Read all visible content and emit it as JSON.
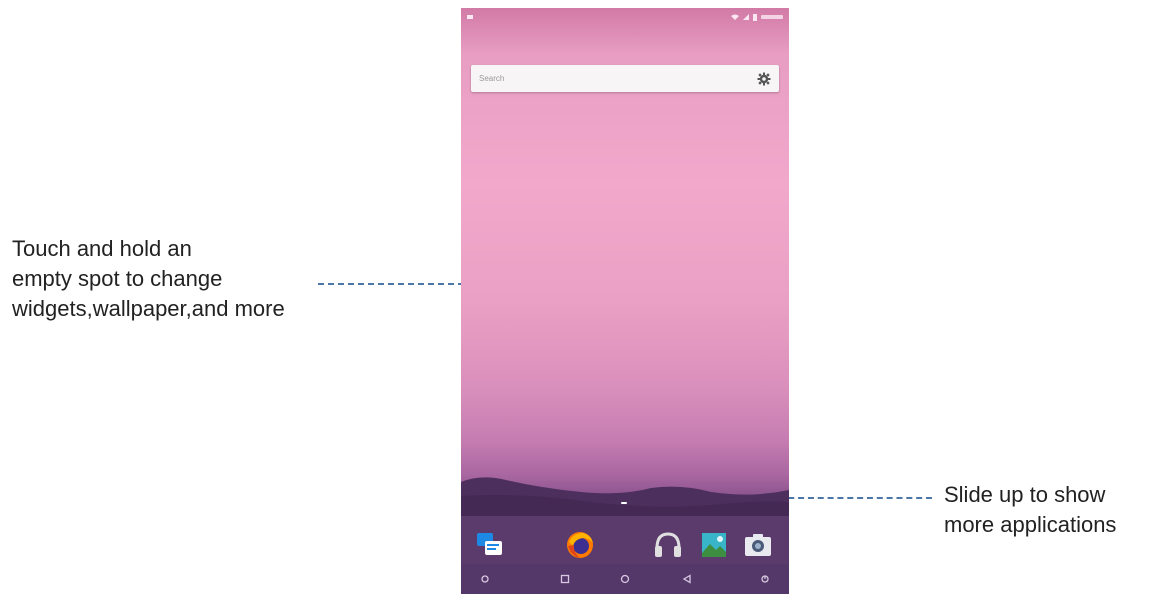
{
  "annotations": {
    "left_callout_lines": [
      "Touch and hold an",
      "empty spot to change",
      "widgets,wallpaper,and more"
    ],
    "right_callout_lines": [
      "Slide up to show",
      "more applications"
    ]
  },
  "phone": {
    "search": {
      "placeholder": "Search",
      "settings_icon": "gear-icon"
    },
    "dock_apps": [
      {
        "name": "messaging",
        "icon": "messages-icon"
      },
      {
        "name": "firefox",
        "icon": "firefox-icon"
      },
      {
        "name": "music",
        "icon": "headphones-icon"
      },
      {
        "name": "gallery",
        "icon": "gallery-icon"
      },
      {
        "name": "camera",
        "icon": "camera-icon"
      }
    ],
    "nav_buttons": [
      {
        "icon": "nav-left-icon"
      },
      {
        "icon": "square-icon"
      },
      {
        "icon": "circle-icon"
      },
      {
        "icon": "back-triangle-icon"
      },
      {
        "icon": "nav-right-icon"
      }
    ]
  },
  "colors": {
    "callout_text": "#222222",
    "callout_line": "#4a76a8",
    "dock_bg": "#5b3a6c",
    "nav_bg": "#55386a"
  }
}
